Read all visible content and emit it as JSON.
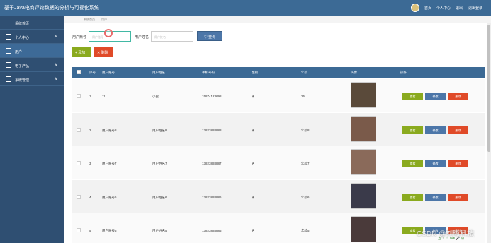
{
  "app": {
    "title": "基于Java电商评论数据的分析与可视化系统",
    "nav": [
      "首页",
      "个人中心",
      "退出",
      "退出登录"
    ]
  },
  "sidebar": {
    "items": [
      {
        "label": "系统首页",
        "icon": "home-icon"
      },
      {
        "label": "个人中心",
        "icon": "person-icon",
        "chevron": "∨"
      },
      {
        "label": "用户",
        "icon": "user-icon"
      },
      {
        "label": "电子产品",
        "icon": "product-icon",
        "chevron": "∨"
      },
      {
        "label": "系统管理",
        "icon": "settings-icon",
        "chevron": "∨"
      }
    ]
  },
  "breadcrumb": [
    "系统首页",
    "用户"
  ],
  "search": {
    "account_label": "用户账号",
    "account_placeholder": "用户账号",
    "name_label": "用户姓名",
    "name_placeholder": "用户姓名",
    "button": "♡ 查询"
  },
  "actions": {
    "add": "+ 添加",
    "delete": "✕ 删除"
  },
  "table": {
    "headers": [
      "序号",
      "用户账号",
      "用户姓名",
      "手机号码",
      "性别",
      "年龄",
      "头像",
      "操作"
    ],
    "row_buttons": {
      "view": "查看",
      "edit": "修改",
      "remove": "删除"
    },
    "rows": [
      {
        "index": "1",
        "account": "11",
        "name": "小蜜",
        "phone": "15874123698",
        "gender": "男",
        "age": "25",
        "photo_color": "#5a4a3a"
      },
      {
        "index": "2",
        "account": "用户账号8",
        "name": "用户姓名8",
        "phone": "13823888888",
        "gender": "男",
        "age": "年龄8",
        "photo_color": "#7a5a4a"
      },
      {
        "index": "3",
        "account": "用户账号7",
        "name": "用户姓名7",
        "phone": "13823888887",
        "gender": "男",
        "age": "年龄7",
        "photo_color": "#8a6a5a"
      },
      {
        "index": "4",
        "account": "用户账号6",
        "name": "用户姓名6",
        "phone": "13823888886",
        "gender": "男",
        "age": "年龄6",
        "photo_color": "#3a3a4a"
      },
      {
        "index": "5",
        "account": "用户账号5",
        "name": "用户姓名5",
        "phone": "13823888885",
        "gender": "男",
        "age": "年龄5",
        "photo_color": "#4a3a3a"
      }
    ]
  },
  "watermark": "CSDN @刘晰科技",
  "ime_bar": "五 ♪ ☺ ⌨ 🎤 ⊞"
}
